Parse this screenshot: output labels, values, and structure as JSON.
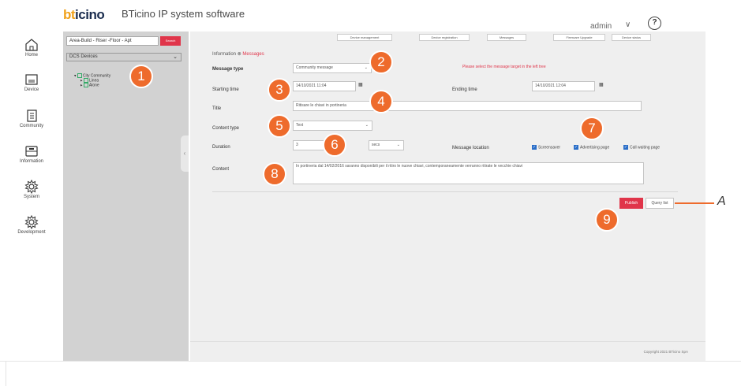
{
  "header": {
    "logo_text_b": "bt",
    "logo_text_rest": "icino",
    "app_title": "BTicino IP system software",
    "user_name": "admin",
    "user_chevron": "∨",
    "help_symbol": "?"
  },
  "nav": [
    {
      "label": "Home",
      "icon": "home-icon"
    },
    {
      "label": "Device",
      "icon": "device-icon"
    },
    {
      "label": "Community",
      "icon": "community-icon"
    },
    {
      "label": "Information",
      "icon": "information-icon"
    },
    {
      "label": "System",
      "icon": "system-gear-icon"
    },
    {
      "label": "Development",
      "icon": "development-gear-icon"
    }
  ],
  "tree": {
    "search_text": "Area-Build - Riser -Floor - Apt",
    "search_button": "Search",
    "select_value": "DCS Devices",
    "nodes": [
      "City Community",
      "Linea",
      "Alone"
    ]
  },
  "toolbar": {
    "buttons": [
      "Device management",
      "Device registration",
      "Messages",
      "Firmware Upgrade",
      "Device status"
    ]
  },
  "breadcrumb": {
    "parent": "Information",
    "separator": "⊗",
    "current": "Messages"
  },
  "form": {
    "message_type_label": "Message type",
    "message_type_value": "Community message",
    "hint": "Please select the message target in the left tree",
    "starting_time_label": "Starting time",
    "starting_time_value": "14/10/2021 11:04",
    "ending_time_label": "Ending time",
    "ending_time_value": "14/10/2021 12:04",
    "title_label": "Title",
    "title_value": "Ritisare le chiavi in portineria",
    "content_type_label": "Content type",
    "content_type_value": "Text",
    "duration_label": "Duration",
    "duration_value": "3",
    "duration_unit": "secs",
    "message_location_label": "Message location",
    "locations": [
      "Screensaver",
      "Advertising page",
      "Call waiting page"
    ],
    "content_label": "Content",
    "content_value": "In portineria dal 14/02/2016 saranno disponibili per il ritiro le nuove chiavi, contemporaneamente verranno ritirate le vecchie chiavi"
  },
  "actions": {
    "publish": "Publish",
    "query_list": "Query list"
  },
  "footer": {
    "copyright": "Copyright 2021 BTicino SpA"
  },
  "callouts": [
    "1",
    "2",
    "3",
    "4",
    "5",
    "6",
    "7",
    "8",
    "9"
  ],
  "external_label": "A",
  "colors": {
    "accent_red": "#e0354a",
    "callout_orange": "#ee6b2c",
    "tree_panel_bg": "#d2d2d2",
    "main_bg": "#efefef"
  }
}
